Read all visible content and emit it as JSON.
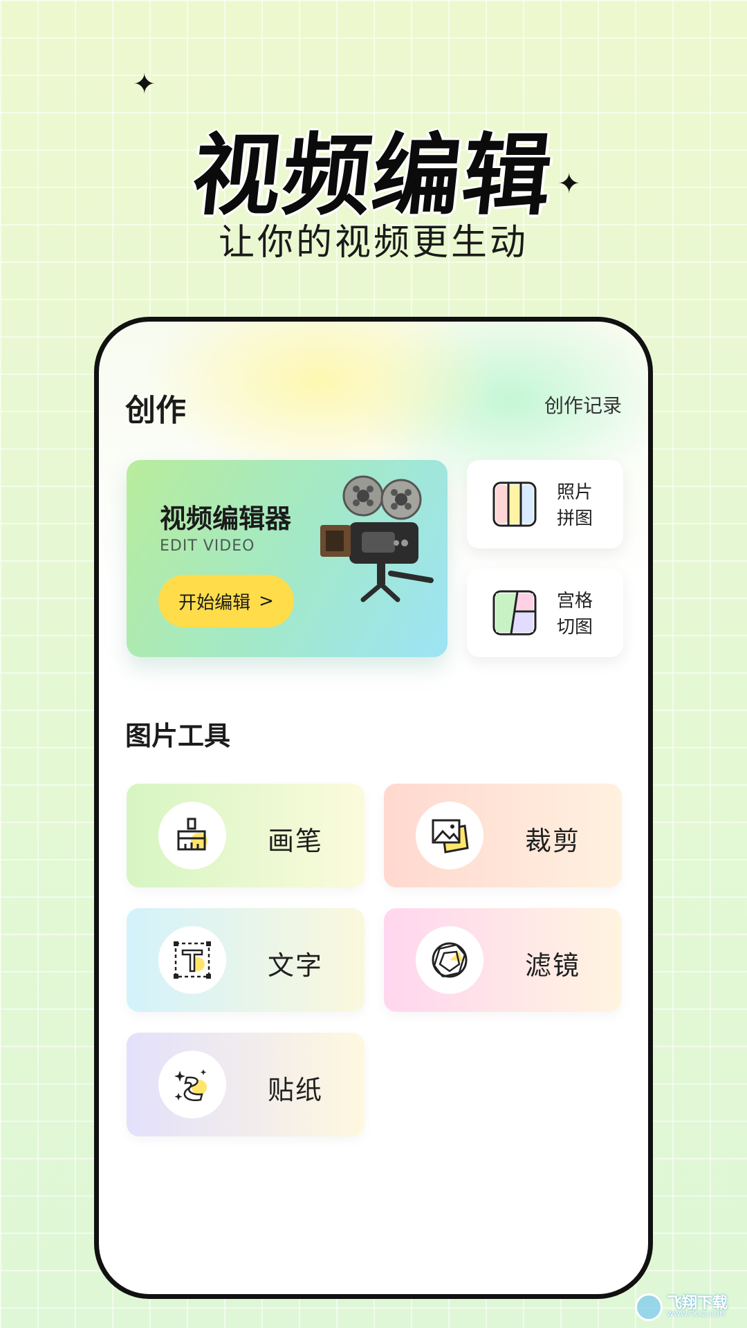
{
  "hero": {
    "title": "视频编辑",
    "subtitle": "让你的视频更生动"
  },
  "create_section": {
    "title": "创作",
    "records_link": "创作记录"
  },
  "video_card": {
    "title": "视频编辑器",
    "subtitle": "EDIT VIDEO",
    "button_label": "开始编辑",
    "button_arrow": ">",
    "illustration": "film-camera-icon"
  },
  "side_cards": [
    {
      "label_line1": "照片",
      "label_line2": "拼图",
      "icon": "photo-collage-icon"
    },
    {
      "label_line1": "宫格",
      "label_line2": "切图",
      "icon": "grid-cut-icon"
    }
  ],
  "tools_section": {
    "title": "图片工具"
  },
  "tools": [
    {
      "name": "画笔",
      "icon": "brush-icon"
    },
    {
      "name": "裁剪",
      "icon": "crop-image-icon"
    },
    {
      "name": "文字",
      "icon": "text-icon"
    },
    {
      "name": "滤镜",
      "icon": "filter-aperture-icon"
    },
    {
      "name": "贴纸",
      "icon": "sticker-icon"
    }
  ],
  "watermark": {
    "main": "飞翔下载",
    "url": "WWW.FXXZ.COM"
  },
  "colors": {
    "accent_yellow": "#ffdc4a",
    "video_card_start": "#b9ec9c",
    "video_card_end": "#9de3f5",
    "text_dark": "#1b1b1b"
  }
}
